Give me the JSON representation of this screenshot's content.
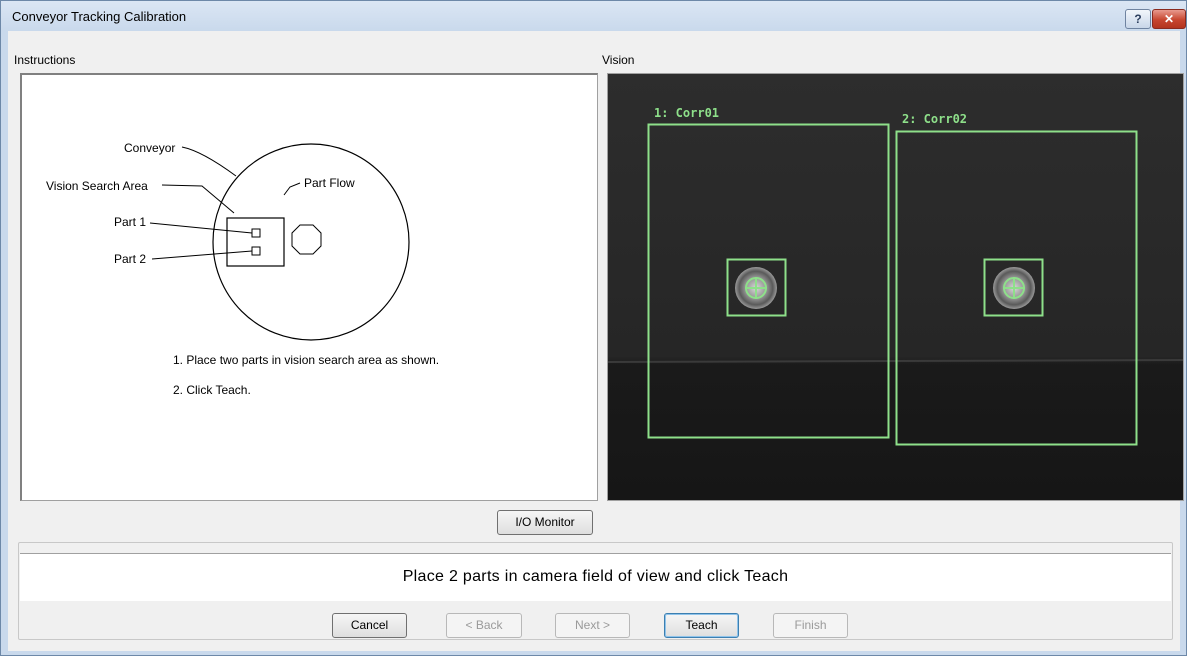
{
  "window": {
    "title": "Conveyor Tracking Calibration",
    "help_label": "?",
    "close_label": "✕"
  },
  "instructions": {
    "caption": "Instructions",
    "diagram": {
      "conveyor_label": "Conveyor",
      "vision_area_label": "Vision Search Area",
      "part_flow_label": "Part Flow",
      "part1_label": "Part 1",
      "part2_label": "Part 2"
    },
    "step1": "1. Place two parts in vision search area as shown.",
    "step2": "2. Click Teach."
  },
  "vision": {
    "caption": "Vision",
    "rois": [
      {
        "label": "1: Corr01"
      },
      {
        "label": "2: Corr02"
      }
    ],
    "roi_color": "#8ee08a"
  },
  "io_monitor_label": "I/O Monitor",
  "status_message": "Place 2 parts in camera field of view and click Teach",
  "buttons": {
    "cancel": "Cancel",
    "back": "< Back",
    "next": "Next >",
    "teach": "Teach",
    "finish": "Finish"
  }
}
